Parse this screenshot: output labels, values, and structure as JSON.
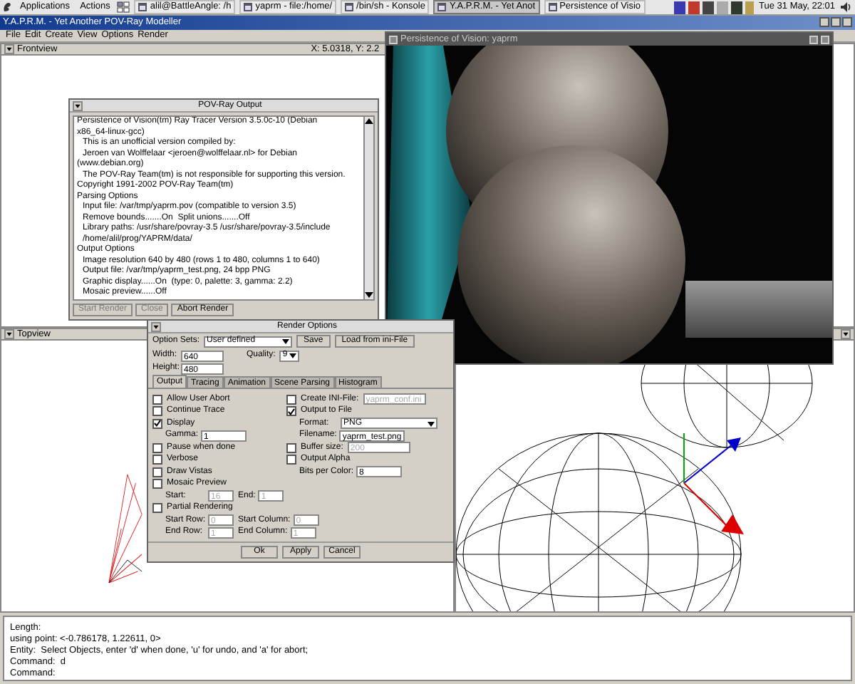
{
  "taskbar": {
    "menus": [
      "Applications",
      "Actions"
    ],
    "tasks": [
      {
        "label": "alil@BattleAngle: /h",
        "selected": false
      },
      {
        "label": "yaprm - file:/home/",
        "selected": false
      },
      {
        "label": "/bin/sh - Konsole",
        "selected": false
      },
      {
        "label": "Y.A.P.R.M. - Yet Anot",
        "selected": true
      },
      {
        "label": "Persistence of Visio",
        "selected": false
      }
    ],
    "clock": "Tue 31 May, 22:01"
  },
  "main_window": {
    "title": "Y.A.P.R.M. - Yet Another POV-Ray Modeller",
    "menu": [
      "File",
      "Edit",
      "Create",
      "View",
      "Options",
      "Render"
    ],
    "frontview": {
      "title": "Frontview",
      "coords": "X: 5.0318, Y: 2.2"
    },
    "topview": {
      "title": "Topview"
    },
    "console": [
      "Length:",
      "using point: <-0.786178, 1.22611, 0>",
      "Entity:  Select Objects, enter 'd' when done, 'u' for undo, and 'a' for abort;",
      "Command:  d",
      "Command:"
    ]
  },
  "render_window": {
    "title": "Persistence of Vision: yaprm"
  },
  "output_dialog": {
    "title": "POV-Ray Output",
    "lines": [
      {
        "text": "Persistence of Vision(tm) Ray Tracer Version 3.5.0c-10 (Debian",
        "indented": false
      },
      {
        "text": "x86_64-linux-gcc)",
        "indented": false
      },
      {
        "text": "This is an unofficial version compiled by:",
        "indented": true
      },
      {
        "text": "Jeroen van Wolffelaar <jeroen@wolffelaar.nl> for Debian",
        "indented": true
      },
      {
        "text": "(www.debian.org)",
        "indented": false
      },
      {
        "text": "The POV-Ray Team(tm) is not responsible for supporting this version.",
        "indented": true
      },
      {
        "text": "Copyright 1991-2002 POV-Ray Team(tm)",
        "indented": false
      },
      {
        "text": "Parsing Options",
        "indented": false
      },
      {
        "text": "Input file: /var/tmp/yaprm.pov (compatible to version 3.5)",
        "indented": true
      },
      {
        "text": "Remove bounds.......On  Split unions.......Off",
        "indented": true
      },
      {
        "text": "Library paths: /usr/share/povray-3.5 /usr/share/povray-3.5/include",
        "indented": true
      },
      {
        "text": "/home/alil/prog/YAPRM/data/",
        "indented": true
      },
      {
        "text": "Output Options",
        "indented": false
      },
      {
        "text": "Image resolution 640 by 480 (rows 1 to 480, columns 1 to 640)",
        "indented": true
      },
      {
        "text": "Output file: /var/tmp/yaprm_test.png, 24 bpp PNG",
        "indented": true
      },
      {
        "text": "Graphic display......On  (type: 0, palette: 3, gamma: 2.2)",
        "indented": true
      },
      {
        "text": "Mosaic preview......Off",
        "indented": true
      }
    ],
    "buttons": [
      {
        "label": "Start Render",
        "disabled": true
      },
      {
        "label": "Close",
        "disabled": true
      },
      {
        "label": "Abort Render",
        "disabled": false
      }
    ]
  },
  "render_options": {
    "title": "Render Options",
    "option_sets_label": "Option Sets:",
    "option_set": "User defined",
    "buttons": [
      "Save",
      "Load from ini-File"
    ],
    "size": [
      {
        "label": "Width:",
        "value": "640"
      },
      {
        "label": "Height:",
        "value": "480"
      }
    ],
    "quality": {
      "label": "Quality:",
      "value": "9"
    },
    "tabs": [
      {
        "label": "Output",
        "selected": true
      },
      {
        "label": "Tracing",
        "selected": false
      },
      {
        "label": "Animation",
        "selected": false
      },
      {
        "label": "Scene Parsing",
        "selected": false
      },
      {
        "label": "Histogram",
        "selected": false
      }
    ],
    "left": [
      {
        "kind": "checkbox",
        "label": "Allow User Abort",
        "checked": false
      },
      {
        "kind": "checkbox",
        "label": "Continue Trace",
        "checked": false
      },
      {
        "kind": "checkbox",
        "label": "Display",
        "checked": true
      },
      {
        "kind": "fields",
        "fields": [
          {
            "label": "Gamma:",
            "value": "1",
            "disabled": false
          }
        ]
      },
      {
        "kind": "checkbox",
        "label": "Pause when done",
        "checked": false
      },
      {
        "kind": "checkbox",
        "label": "Verbose",
        "checked": false
      },
      {
        "kind": "checkbox",
        "label": "Draw Vistas",
        "checked": false
      },
      {
        "kind": "checkbox",
        "label": "Mosaic Preview",
        "checked": false
      },
      {
        "kind": "fields",
        "fields": [
          {
            "label": "Start:",
            "value": "16",
            "disabled": true
          },
          {
            "label": "End:",
            "value": "1",
            "disabled": true
          }
        ]
      },
      {
        "kind": "checkbox",
        "label": "Partial Rendering",
        "checked": false
      },
      {
        "kind": "fields",
        "fields": [
          {
            "label": "Start Row:",
            "value": "0",
            "disabled": true
          },
          {
            "label": "Start Column:",
            "value": "0",
            "disabled": true
          }
        ]
      },
      {
        "kind": "fields",
        "fields": [
          {
            "label": "End Row:",
            "value": "1",
            "disabled": true
          },
          {
            "label": "End Column:",
            "value": "1",
            "disabled": true
          }
        ]
      }
    ],
    "right": [
      {
        "kind": "checkbox_field",
        "label": "Create INI-File:",
        "checked": false,
        "value": "yaprm_conf.ini",
        "disabled": true
      },
      {
        "kind": "checkbox",
        "label": "Output to File",
        "checked": true
      },
      {
        "kind": "select",
        "label": "Format:",
        "value": "PNG"
      },
      {
        "kind": "fields",
        "fields": [
          {
            "label": "Filename:",
            "value": "yaprm_test.png",
            "disabled": false
          }
        ]
      },
      {
        "kind": "checkbox_field",
        "label": "Buffer size:",
        "checked": false,
        "value": "200",
        "disabled": true
      },
      {
        "kind": "checkbox",
        "label": "Output Alpha",
        "checked": false
      },
      {
        "kind": "fields",
        "fields": [
          {
            "label": "Bits per Color:",
            "value": "8",
            "disabled": false
          }
        ]
      }
    ],
    "footer": [
      "Ok",
      "Apply",
      "Cancel"
    ]
  }
}
